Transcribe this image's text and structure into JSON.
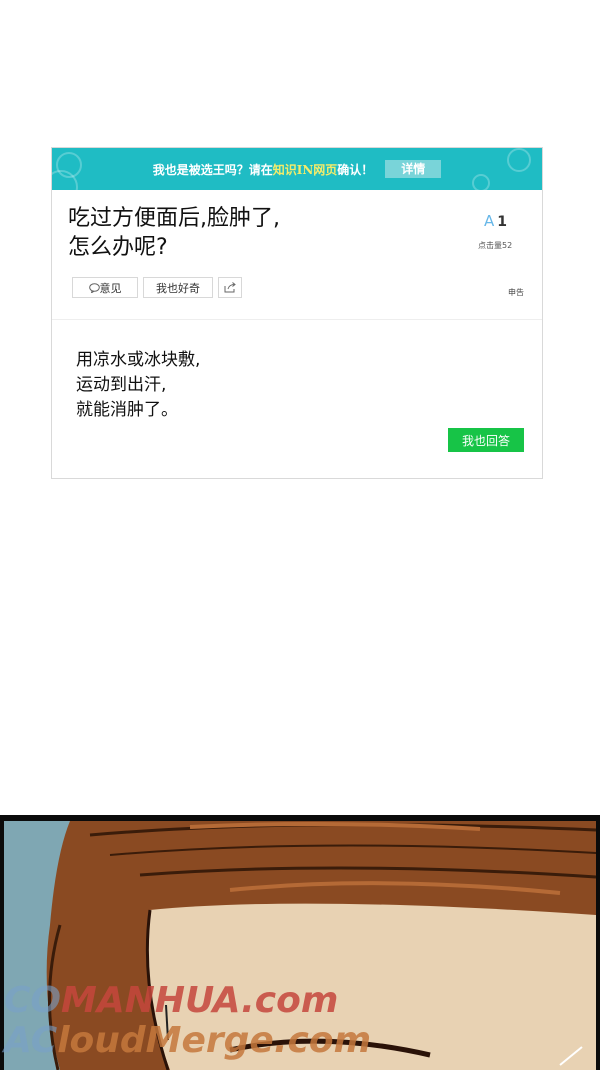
{
  "banner": {
    "text_before": "我也是被选王吗？请在",
    "text_highlight": "知识IN网页",
    "text_after": "确认！",
    "button": "详情"
  },
  "question": {
    "line1": "吃过方便面后,脸肿了,",
    "line2": "怎么办呢?"
  },
  "stats": {
    "answer_icon": "A",
    "answer_count": "1",
    "clicks": "点击量52"
  },
  "actions": {
    "opinion": "意见",
    "curious": "我也好奇",
    "report": "申告"
  },
  "answer": {
    "line1": "用凉水或冰块敷,",
    "line2": "运动到出汗,",
    "line3": "就能消肿了。"
  },
  "reply_button": "我也回答",
  "watermark": {
    "line1_prefix": "CO",
    "line1": "MANHUA.com",
    "line2_prefix": "AC",
    "line2": "loudMerge.com"
  },
  "colors": {
    "banner": "#1fbcc4",
    "highlight": "#f4ec6a",
    "reply_button": "#17c447",
    "answer_icon": "#67b7e8"
  }
}
